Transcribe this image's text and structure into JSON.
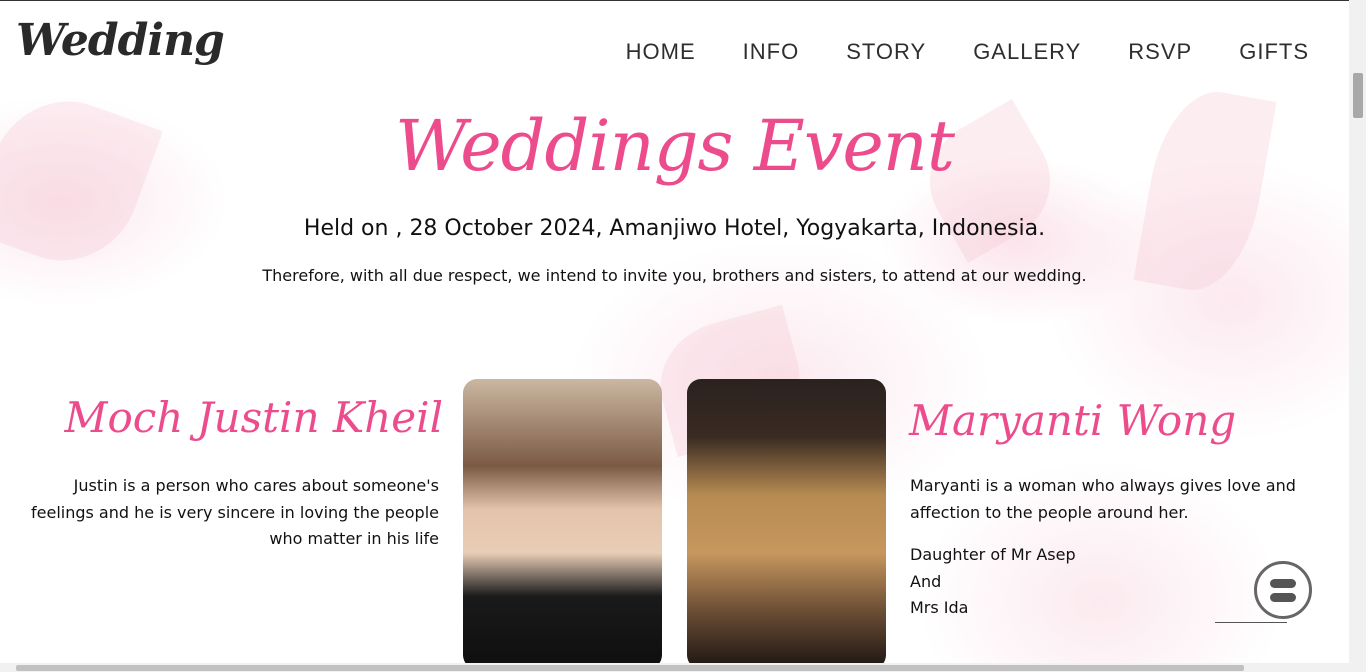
{
  "header": {
    "logo": "Wedding",
    "nav": [
      "HOME",
      "INFO",
      "STORY",
      "GALLERY",
      "RSVP",
      "GIFTS"
    ]
  },
  "hero": {
    "title": "Weddings Event",
    "held": "Held on , 28 October 2024, Amanjiwo Hotel, Yogyakarta, Indonesia.",
    "invite": "Therefore, with all due respect, we intend to invite you, brothers and sisters, to attend at our wedding."
  },
  "groom": {
    "name": "Moch Justin Kheil",
    "bio": "Justin is a person who cares about someone's feelings and he is very sincere in loving the people who matter in his life"
  },
  "bride": {
    "name": "Maryanti Wong",
    "bio": "Maryanti is a woman who always gives love and affection to the people around her.",
    "parents_line1": "Daughter of Mr Asep",
    "parents_line2": "And",
    "parents_line3": "Mrs Ida"
  },
  "colors": {
    "accent": "#ec4c8c",
    "text": "#111111"
  },
  "icons": {
    "chat": "chat-bubble-icon"
  }
}
